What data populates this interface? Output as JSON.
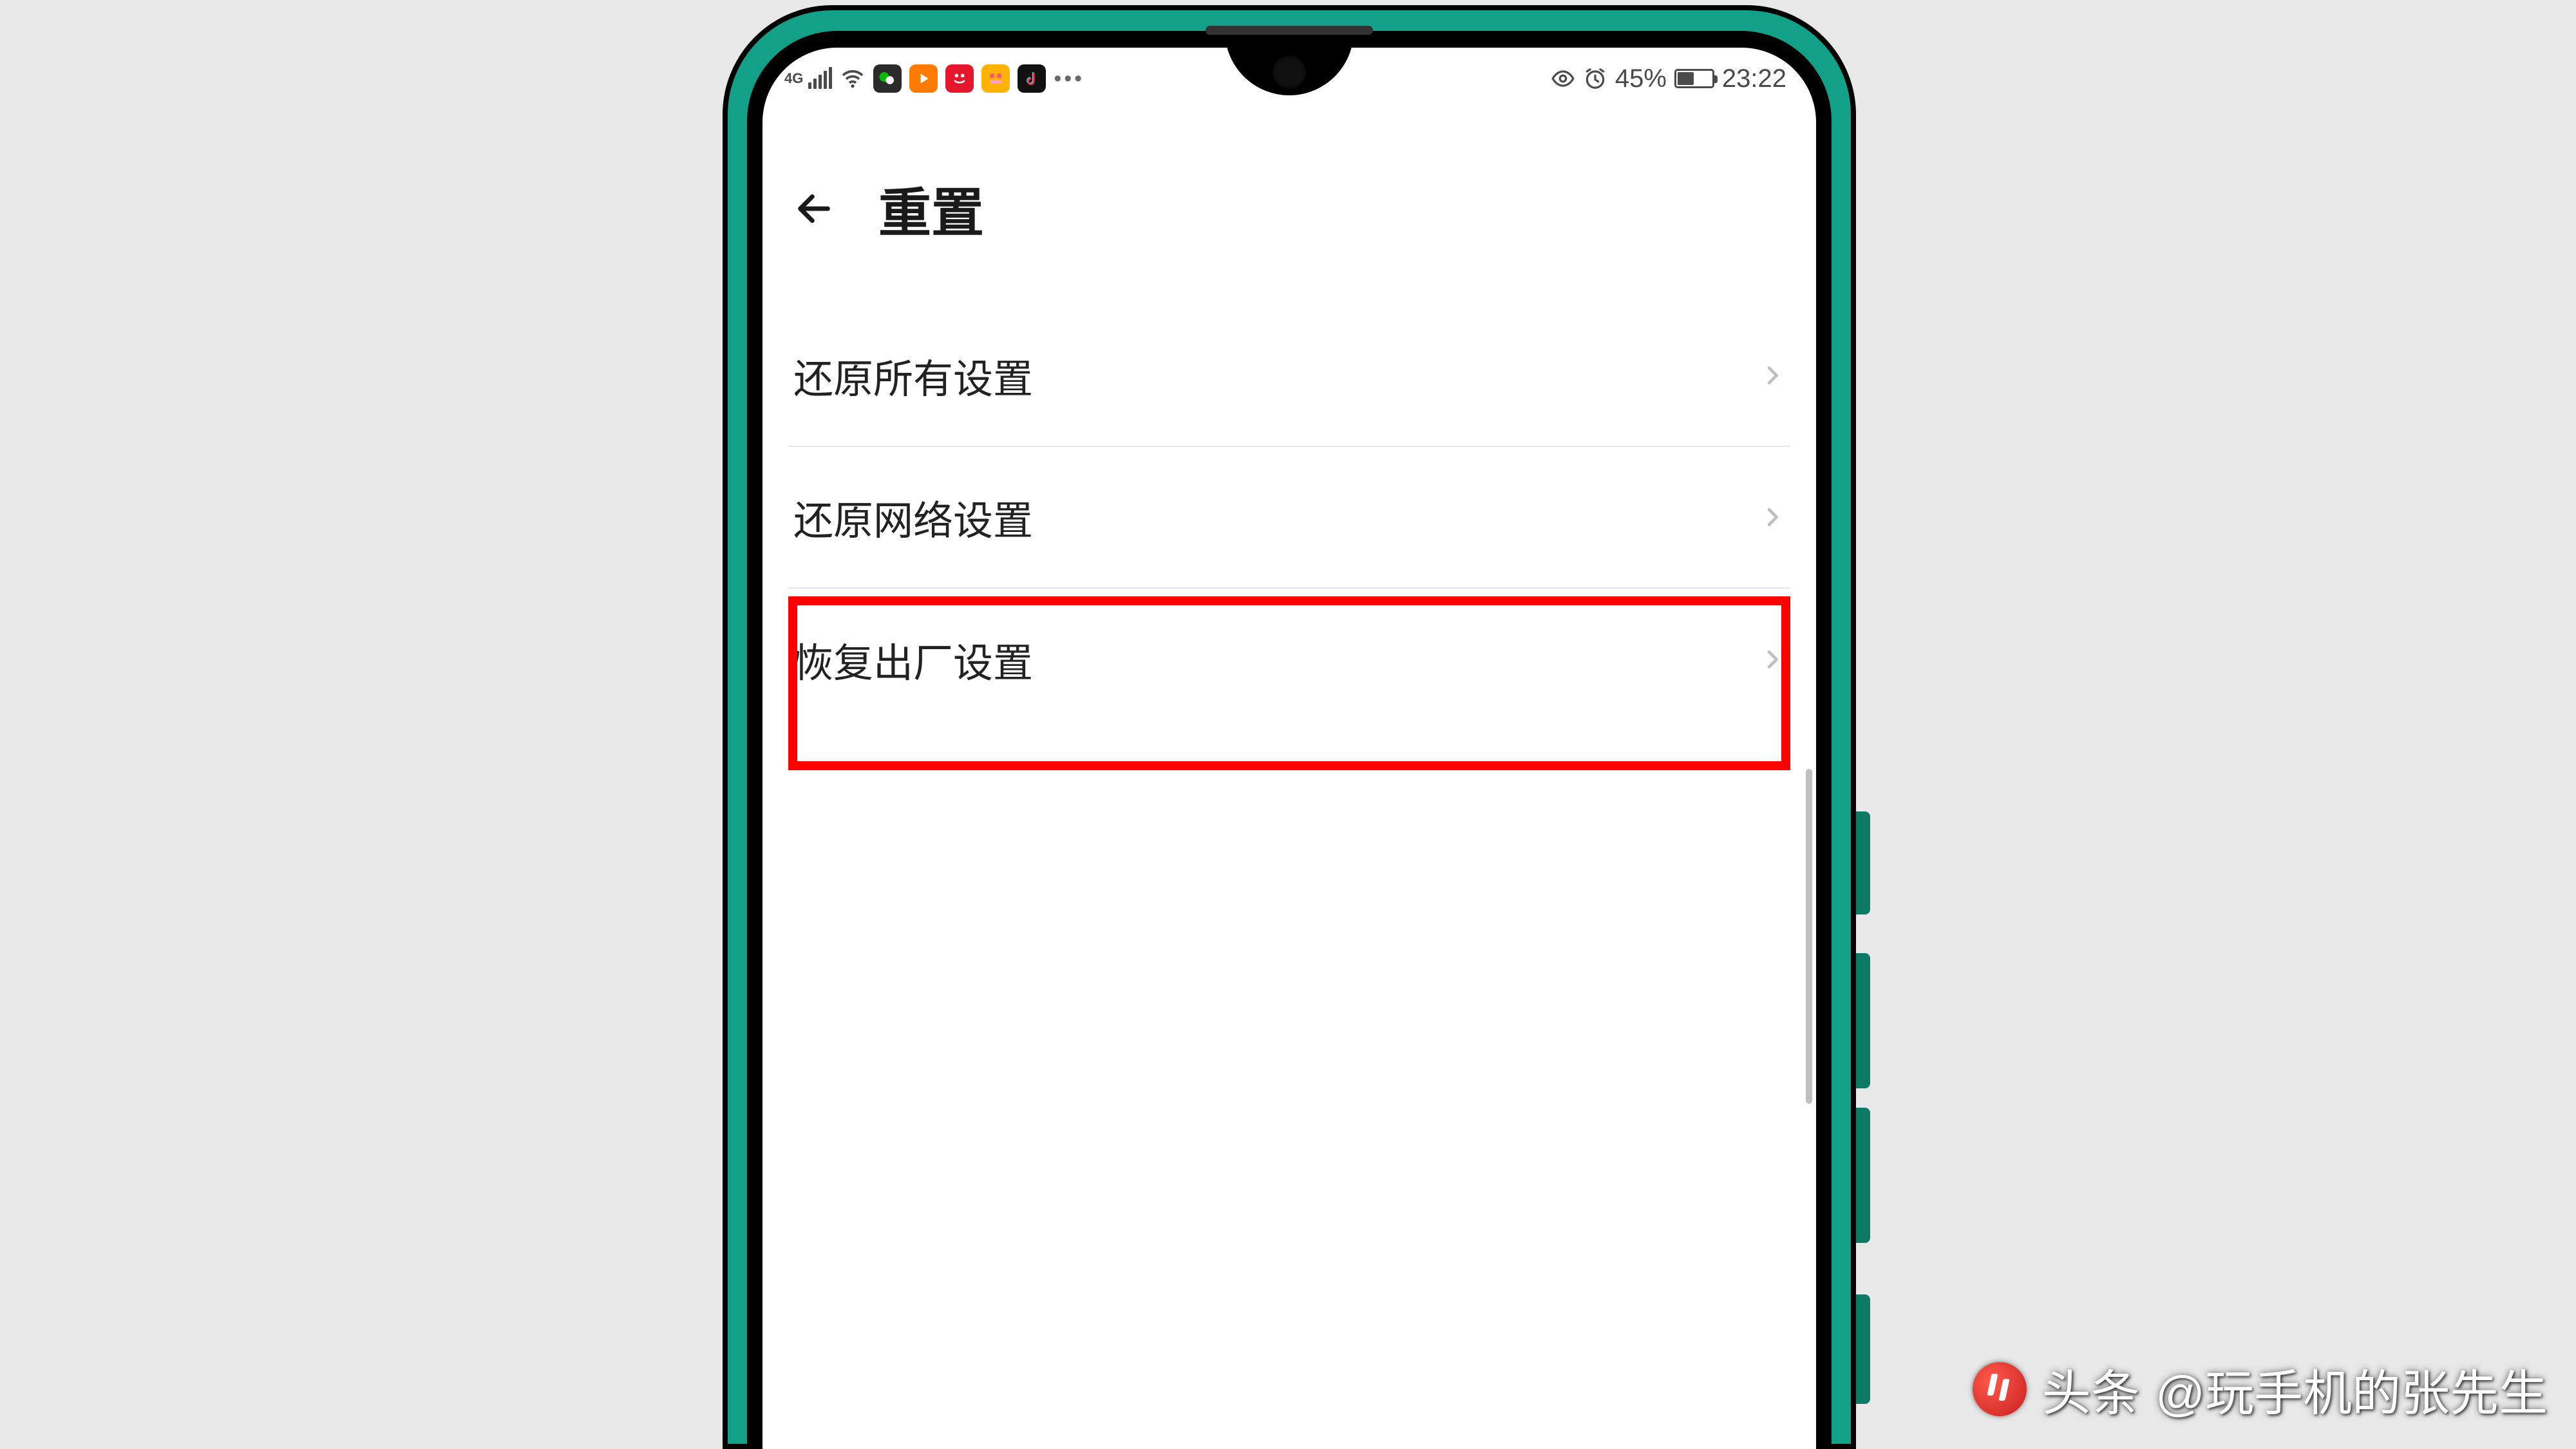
{
  "statusbar": {
    "network_label": "4G",
    "battery_percent_text": "45%",
    "battery_fill_percent": 45,
    "time": "23:22",
    "more_dots": "•••",
    "app_icons": [
      {
        "name": "wechat-icon"
      },
      {
        "name": "video-icon"
      },
      {
        "name": "weibo-icon"
      },
      {
        "name": "face-icon"
      },
      {
        "name": "douyin-icon"
      }
    ]
  },
  "header": {
    "title": "重置"
  },
  "list": {
    "items": [
      {
        "label": "还原所有设置",
        "highlighted": false
      },
      {
        "label": "还原网络设置",
        "highlighted": false
      },
      {
        "label": "恢复出厂设置",
        "highlighted": true
      }
    ]
  },
  "watermark": {
    "brand": "头条",
    "author_prefix": "@",
    "author": "玩手机的张先生"
  }
}
